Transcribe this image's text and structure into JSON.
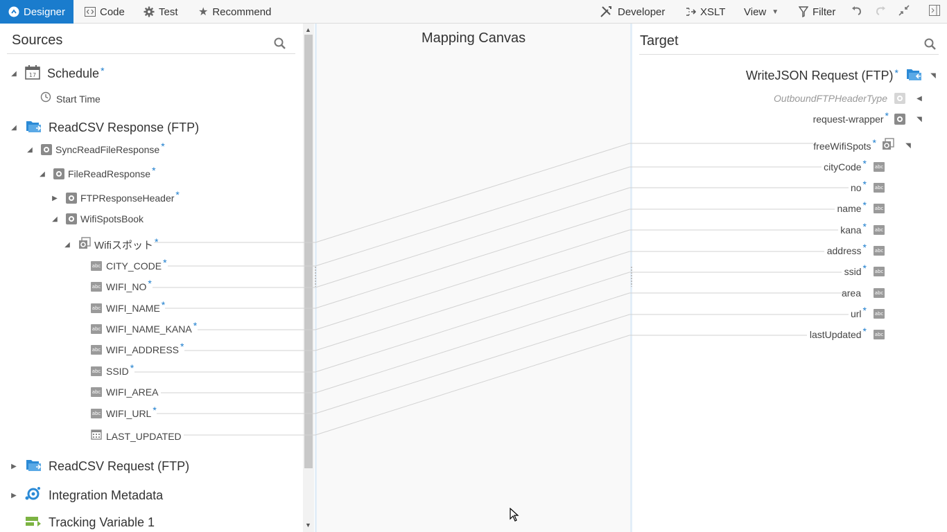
{
  "toolbar": {
    "designer": "Designer",
    "code": "Code",
    "test": "Test",
    "recommend": "Recommend",
    "developer": "Developer",
    "xslt": "XSLT",
    "view": "View",
    "filter": "Filter"
  },
  "sources": {
    "title": "Sources",
    "schedule": "Schedule",
    "start_time": "Start Time",
    "read_csv_response": "ReadCSV Response (FTP)",
    "sync_read_file_response": "SyncReadFileResponse",
    "file_read_response": "FileReadResponse",
    "ftp_response_header": "FTPResponseHeader",
    "wifi_spots_book": "WifiSpotsBook",
    "wifi_spot": "Wifiスポット",
    "fields": [
      "CITY_CODE",
      "WIFI_NO",
      "WIFI_NAME",
      "WIFI_NAME_KANA",
      "WIFI_ADDRESS",
      "SSID",
      "WIFI_AREA",
      "WIFI_URL",
      "LAST_UPDATED"
    ],
    "read_csv_request": "ReadCSV Request (FTP)",
    "integration_metadata": "Integration Metadata",
    "tracking_variable": "Tracking Variable 1"
  },
  "canvas": {
    "title": "Mapping Canvas"
  },
  "target": {
    "title": "Target",
    "write_json_request": "WriteJSON Request (FTP)",
    "outbound_header": "OutboundFTPHeaderType",
    "request_wrapper": "request-wrapper",
    "free_wifi_spots": "freeWifiSpots",
    "fields": [
      "cityCode",
      "no",
      "name",
      "kana",
      "address",
      "ssid",
      "area",
      "url",
      "lastUpdated"
    ]
  },
  "required_marker": "*",
  "colors": {
    "accent": "#1a7ccd",
    "toolbar_bg": "#f7f7f7",
    "canvas_bg": "#f9f9f9"
  }
}
